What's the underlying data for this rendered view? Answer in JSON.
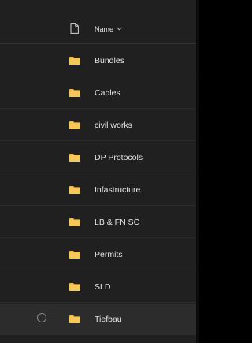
{
  "header": {
    "column_name": "Name",
    "file_type_icon": "file-icon",
    "sort_icon": "chevron-down-icon"
  },
  "folders": [
    {
      "name": "Bundles",
      "icon": "folder-icon"
    },
    {
      "name": "Cables",
      "icon": "folder-icon"
    },
    {
      "name": "civil works",
      "icon": "folder-icon"
    },
    {
      "name": "DP Protocols",
      "icon": "folder-icon"
    },
    {
      "name": "Infastructure",
      "icon": "folder-icon"
    },
    {
      "name": "LB & FN SC",
      "icon": "folder-icon"
    },
    {
      "name": "Permits",
      "icon": "folder-icon"
    },
    {
      "name": "SLD",
      "icon": "folder-icon"
    },
    {
      "name": "Tiefbau",
      "icon": "folder-icon",
      "hovered": true
    }
  ],
  "colors": {
    "background": "#202020",
    "row_hover": "#2c2c2c",
    "divider": "#2b2b2b",
    "text": "#e6e6e6",
    "folder": "#f2c04a"
  }
}
